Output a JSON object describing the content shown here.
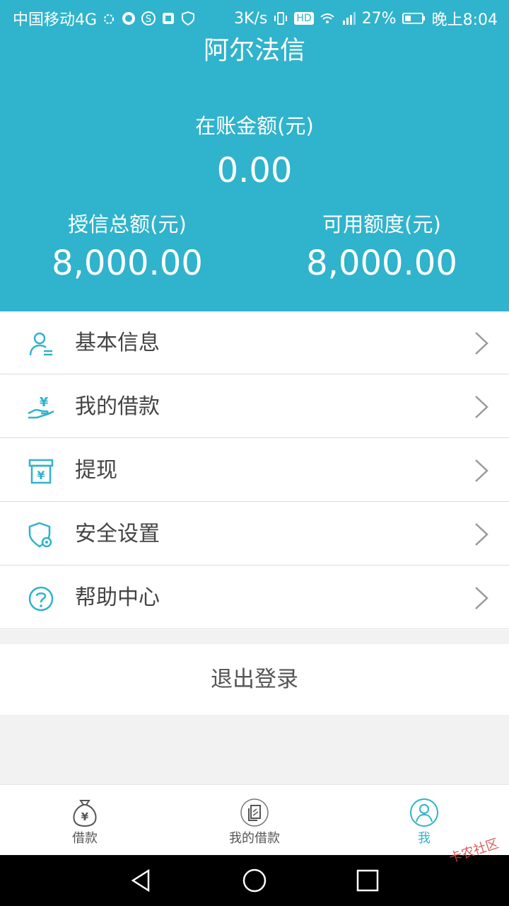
{
  "status_bar": {
    "carrier": "中国移动4G",
    "speed": "3K/s",
    "hd": "HD",
    "battery": "27%",
    "time": "晚上8:04"
  },
  "header": {
    "title": "阿尔法信",
    "balance_label": "在账金额(元)",
    "balance_value": "0.00",
    "credit_total_label": "授信总额(元)",
    "credit_total_value": "8,000.00",
    "available_label": "可用额度(元)",
    "available_value": "8,000.00",
    "bg_color": "#30b3cc"
  },
  "menu": {
    "items": [
      {
        "label": "基本信息",
        "icon": "user-info-icon"
      },
      {
        "label": "我的借款",
        "icon": "hand-money-icon"
      },
      {
        "label": "提现",
        "icon": "withdraw-icon"
      },
      {
        "label": "安全设置",
        "icon": "shield-gear-icon"
      },
      {
        "label": "帮助中心",
        "icon": "help-icon"
      }
    ]
  },
  "logout": {
    "label": "退出登录"
  },
  "tabbar": {
    "tabs": [
      {
        "label": "借款",
        "icon": "money-bag-icon",
        "active": false
      },
      {
        "label": "我的借款",
        "icon": "document-icon",
        "active": false
      },
      {
        "label": "我",
        "icon": "profile-icon",
        "active": true
      }
    ],
    "accent_color": "#2fb3cc"
  },
  "watermark": "卡农社区"
}
